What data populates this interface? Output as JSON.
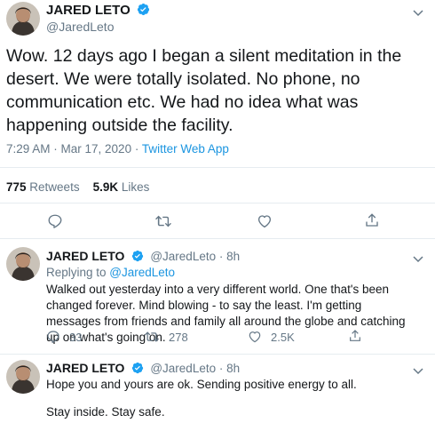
{
  "main_tweet": {
    "author_name": "JARED LETO",
    "author_handle": "@JaredLeto",
    "text": "Wow. 12 days ago I began a silent meditation in the desert. We were totally isolated. No phone, no communication etc. We had no idea what was happening outside the facility.",
    "time": "7:29 AM · Mar 17, 2020 · ",
    "source": "Twitter Web App",
    "retweets_count": "775",
    "retweets_label": "Retweets",
    "likes_count": "5.9K",
    "likes_label": "Likes"
  },
  "replies": [
    {
      "author_name": "JARED LETO",
      "author_handle": "@JaredLeto · 8h",
      "replying_prefix": "Replying to ",
      "replying_to": "@JaredLeto",
      "text": "Walked out yesterday into a very different world. One that's been changed forever. Mind blowing - to say the least. I'm getting messages from friends and family all around the globe and catching up on what's going on.",
      "reply_count": "33",
      "retweet_count": "278",
      "like_count": "2.5K"
    },
    {
      "author_name": "JARED LETO",
      "author_handle": "@JaredLeto · 8h",
      "text_line1": "Hope you and yours are ok. Sending positive energy to all.",
      "text_line2": "Stay inside. Stay safe."
    }
  ],
  "colors": {
    "accent": "#1da1f2",
    "link": "#1b95e0",
    "secondary_text": "#657786",
    "divider": "#e6ecf0"
  },
  "icons": [
    "verified-badge-icon",
    "chevron-down-icon",
    "reply-icon",
    "retweet-icon",
    "like-icon",
    "share-icon"
  ]
}
